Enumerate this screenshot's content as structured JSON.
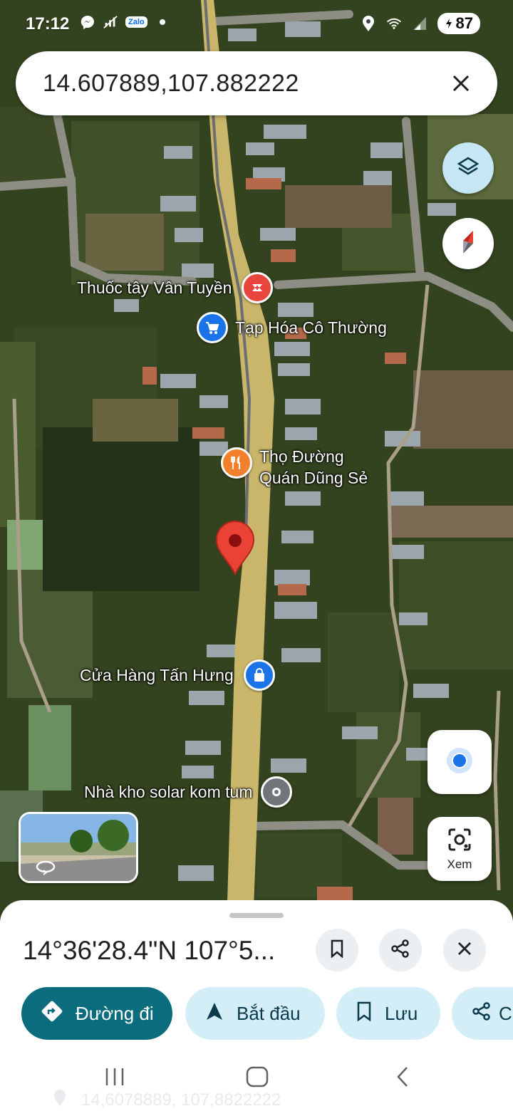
{
  "status_bar": {
    "time": "17:12",
    "zalo_label": "Zalo",
    "battery": "87",
    "icons": [
      "messenger-icon",
      "signal-slash-icon",
      "zalo-icon",
      "dot-icon",
      "location-icon",
      "wifi-icon",
      "cell-signal-icon",
      "battery-icon"
    ]
  },
  "search": {
    "query": "14.607889,107.882222",
    "close_icon": "close-icon"
  },
  "map": {
    "layers_icon": "layers-icon",
    "compass_icon": "compass-icon",
    "my_location_icon": "my-location-icon",
    "lens_label": "Xem",
    "places": [
      {
        "name": "Thuốc tây Vân Tuyền",
        "icon": "pharmacy-icon",
        "color": "#e8453c"
      },
      {
        "name": "Tạp Hóa Cô Thường",
        "icon": "shopping-cart-icon",
        "color": "#1a73e8"
      },
      {
        "name_line1": "Thọ Đường",
        "name_line2": "Quán Dũng Sẻ",
        "icon": "restaurant-icon",
        "color": "#f0802b"
      },
      {
        "name": "Cửa Hàng Tấn Hưng",
        "icon": "shopping-bag-icon",
        "color": "#1a73e8"
      },
      {
        "name": "Nhà kho solar kom tum",
        "icon": "place-pin-icon",
        "color": "#70757a"
      }
    ],
    "dropped_pin_color": "#ea4335"
  },
  "sheet": {
    "coordinates": "14°36'28.4\"N 107°5...",
    "actions": [
      {
        "label": "Đường đi",
        "icon": "directions-icon",
        "primary": true
      },
      {
        "label": "Bắt đầu",
        "icon": "navigation-arrow-icon",
        "primary": false
      },
      {
        "label": "Lưu",
        "icon": "bookmark-icon",
        "primary": false
      },
      {
        "label": "C",
        "icon": "share-icon",
        "primary": false
      }
    ],
    "ghost_text": "14,6078889, 107,8822222"
  },
  "colors": {
    "primary_chip": "#0a6c7c",
    "secondary_chip": "#d3eef7",
    "road": "#c9b66a"
  }
}
